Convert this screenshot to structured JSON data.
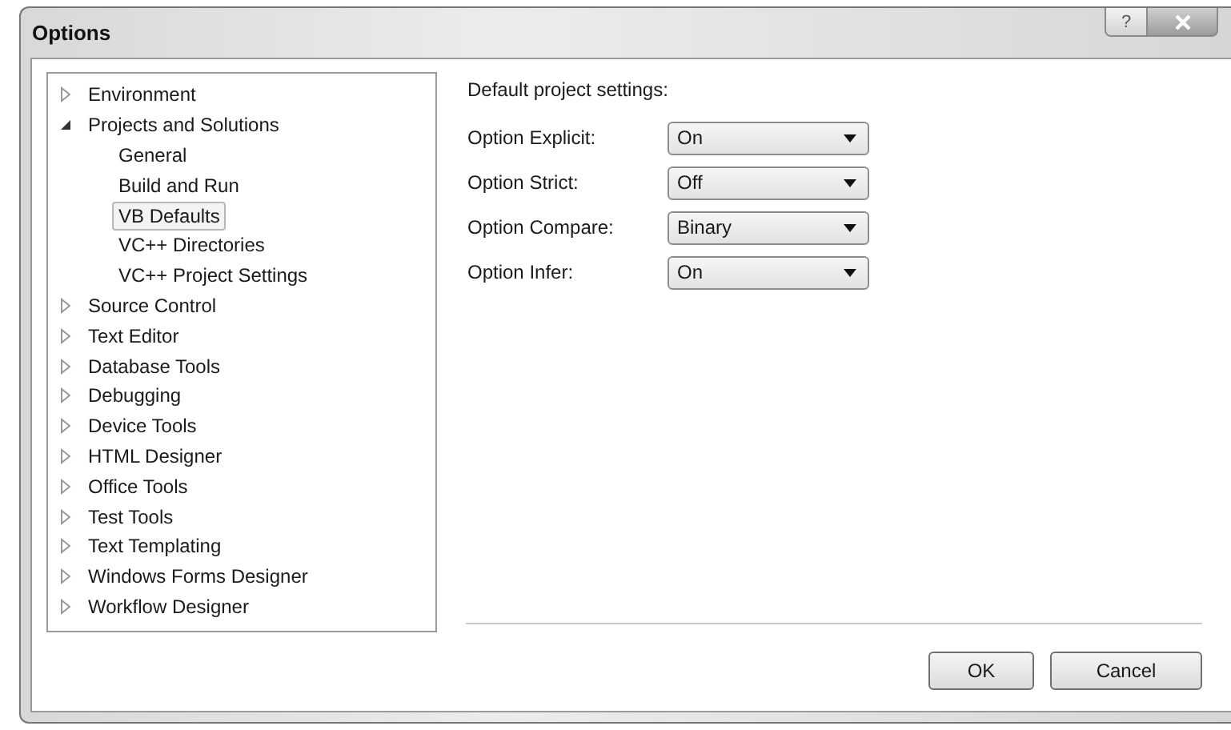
{
  "window": {
    "title": "Options",
    "help_button": "?"
  },
  "tree": [
    {
      "label": "Environment",
      "expanded": false,
      "selected": false
    },
    {
      "label": "Projects and Solutions",
      "expanded": true,
      "selected": false,
      "children": [
        {
          "label": "General",
          "selected": false
        },
        {
          "label": "Build and Run",
          "selected": false
        },
        {
          "label": "VB Defaults",
          "selected": true
        },
        {
          "label": "VC++ Directories",
          "selected": false
        },
        {
          "label": "VC++ Project Settings",
          "selected": false
        }
      ]
    },
    {
      "label": "Source Control",
      "expanded": false,
      "selected": false
    },
    {
      "label": "Text Editor",
      "expanded": false,
      "selected": false
    },
    {
      "label": "Database Tools",
      "expanded": false,
      "selected": false
    },
    {
      "label": "Debugging",
      "expanded": false,
      "selected": false
    },
    {
      "label": "Device Tools",
      "expanded": false,
      "selected": false
    },
    {
      "label": "HTML Designer",
      "expanded": false,
      "selected": false
    },
    {
      "label": "Office Tools",
      "expanded": false,
      "selected": false
    },
    {
      "label": "Test Tools",
      "expanded": false,
      "selected": false
    },
    {
      "label": "Text Templating",
      "expanded": false,
      "selected": false
    },
    {
      "label": "Windows Forms Designer",
      "expanded": false,
      "selected": false
    },
    {
      "label": "Workflow Designer",
      "expanded": false,
      "selected": false
    }
  ],
  "settings": {
    "heading": "Default project settings:",
    "options": [
      {
        "label": "Option Explicit:",
        "value": "On"
      },
      {
        "label": "Option Strict:",
        "value": "Off"
      },
      {
        "label": "Option Compare:",
        "value": "Binary"
      },
      {
        "label": "Option Infer:",
        "value": "On"
      }
    ]
  },
  "buttons": [
    "OK",
    "Cancel"
  ]
}
